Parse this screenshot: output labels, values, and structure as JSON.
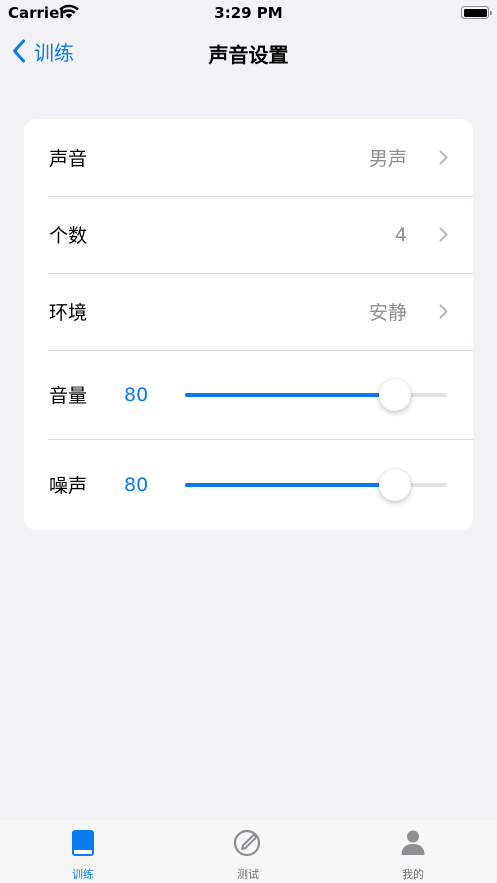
{
  "status_bar": {
    "carrier": "Carrier",
    "time": "3:29 PM"
  },
  "nav": {
    "back_label": "训练",
    "title": "声音设置"
  },
  "settings": {
    "voice": {
      "label": "声音",
      "value": "男声"
    },
    "count": {
      "label": "个数",
      "value": "4"
    },
    "environment": {
      "label": "环境",
      "value": "安静"
    },
    "volume": {
      "label": "音量",
      "value": "80",
      "fraction": 0.8
    },
    "noise": {
      "label": "噪声",
      "value": "80",
      "fraction": 0.8
    }
  },
  "tabs": [
    {
      "label": "训练",
      "icon": "book-icon",
      "active": true
    },
    {
      "label": "测试",
      "icon": "pencil-circle-icon",
      "active": false
    },
    {
      "label": "我的",
      "icon": "person-icon",
      "active": false
    }
  ],
  "colors": {
    "accent": "#0a7cf2",
    "inactive": "#8e8e93",
    "background": "#f2f2f7"
  }
}
